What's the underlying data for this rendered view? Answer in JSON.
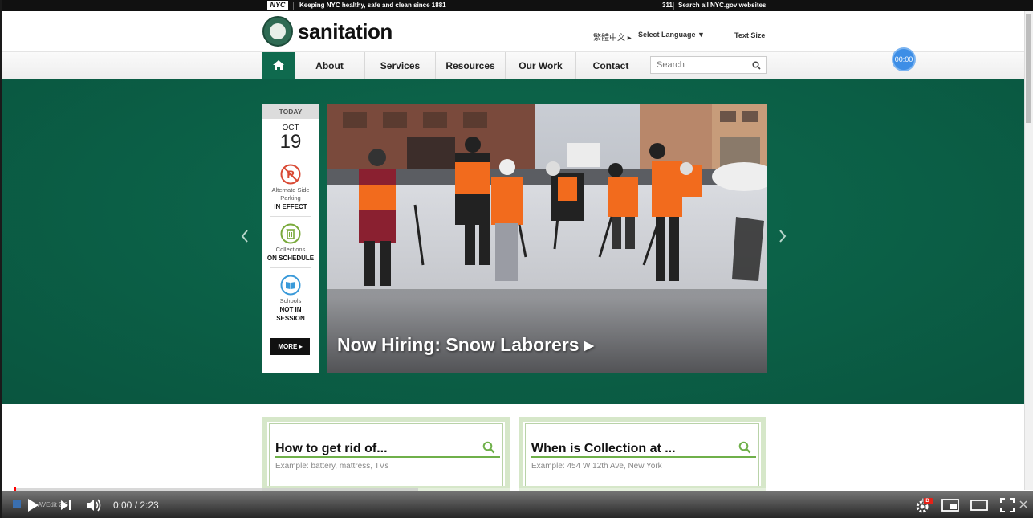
{
  "nyc_bar": {
    "logo": "NYC",
    "tagline": "Keeping NYC healthy, safe and clean since 1881",
    "link_311": "311",
    "search_all": "Search all NYC.gov websites"
  },
  "header": {
    "site_title": "sanitation",
    "lang_chinese": "繁體中文 ▸",
    "select_language": "Select Language  ▼",
    "text_size": "Text Size"
  },
  "nav": {
    "items": [
      {
        "label": "About"
      },
      {
        "label": "Services"
      },
      {
        "label": "Resources"
      },
      {
        "label": "Our Work"
      },
      {
        "label": "Contact"
      }
    ],
    "search_placeholder": "Search"
  },
  "timer": "00:00",
  "today": {
    "head": "TODAY",
    "month": "OCT",
    "day": "19",
    "statuses": [
      {
        "label_1": "Alternate Side",
        "label_2": "Parking",
        "value_1": "IN EFFECT",
        "value_2": ""
      },
      {
        "label_1": "Collections",
        "label_2": "",
        "value_1": "ON SCHEDULE",
        "value_2": ""
      },
      {
        "label_1": "Schools",
        "label_2": "",
        "value_1": "NOT IN",
        "value_2": "SESSION"
      }
    ],
    "more": "MORE ▸"
  },
  "slide": {
    "caption": "Now Hiring: Snow Laborers ▸"
  },
  "lookups": [
    {
      "title": "How to get rid of...",
      "hint": "Example: battery, mattress, TVs"
    },
    {
      "title": "When is Collection at ...",
      "hint": "Example: 454 W 12th Ave, New York"
    }
  ],
  "player": {
    "time": "0:00 / 2:23",
    "progress_played": 0.0,
    "progress_loaded": 0.4,
    "hd_badge": "HD",
    "avedit_label": "AVEdit 2.6"
  },
  "colors": {
    "brand_green": "#0f6a4e",
    "hero_bg": "#0b5f46",
    "lookup_border": "#d6e7c9",
    "accent_line": "#6fb04a"
  }
}
